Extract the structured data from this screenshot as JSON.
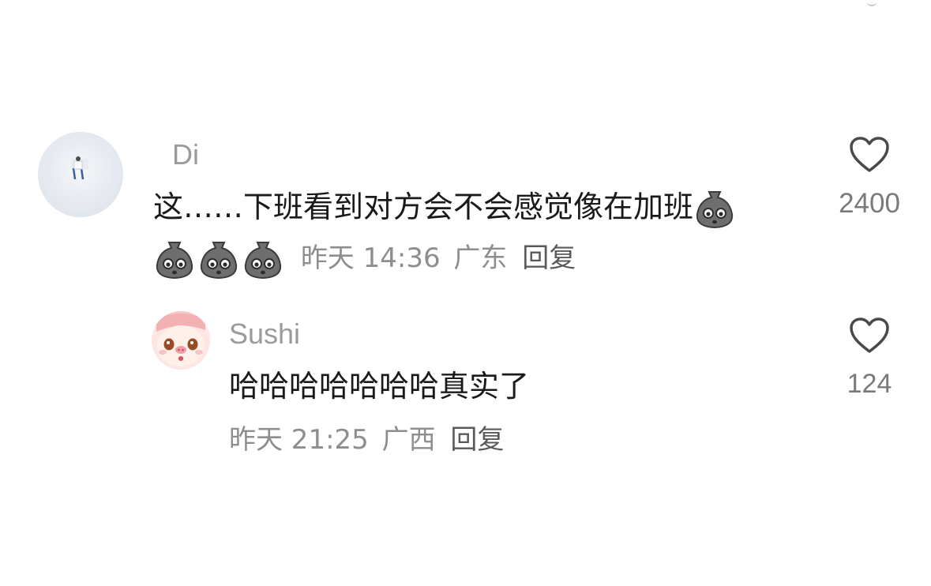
{
  "comments": [
    {
      "username": "Di",
      "text": "这……下班看到对方会不会感觉像在加班",
      "emoji_count_inline": 1,
      "emoji_count_line2": 3,
      "emoji_icon": "stone-face-emoji",
      "time": "昨天 14:36",
      "location": "广东",
      "reply_label": "回复",
      "likes": "2400"
    },
    {
      "username": "Sushi",
      "text": "哈哈哈哈哈哈哈真实了",
      "time": "昨天 21:25",
      "location": "广西",
      "reply_label": "回复",
      "likes": "124"
    }
  ],
  "colors": {
    "text": "#1a1a1a",
    "meta": "#8e8e8e",
    "username": "#9b9b9b",
    "reply": "#5a5a5a"
  }
}
